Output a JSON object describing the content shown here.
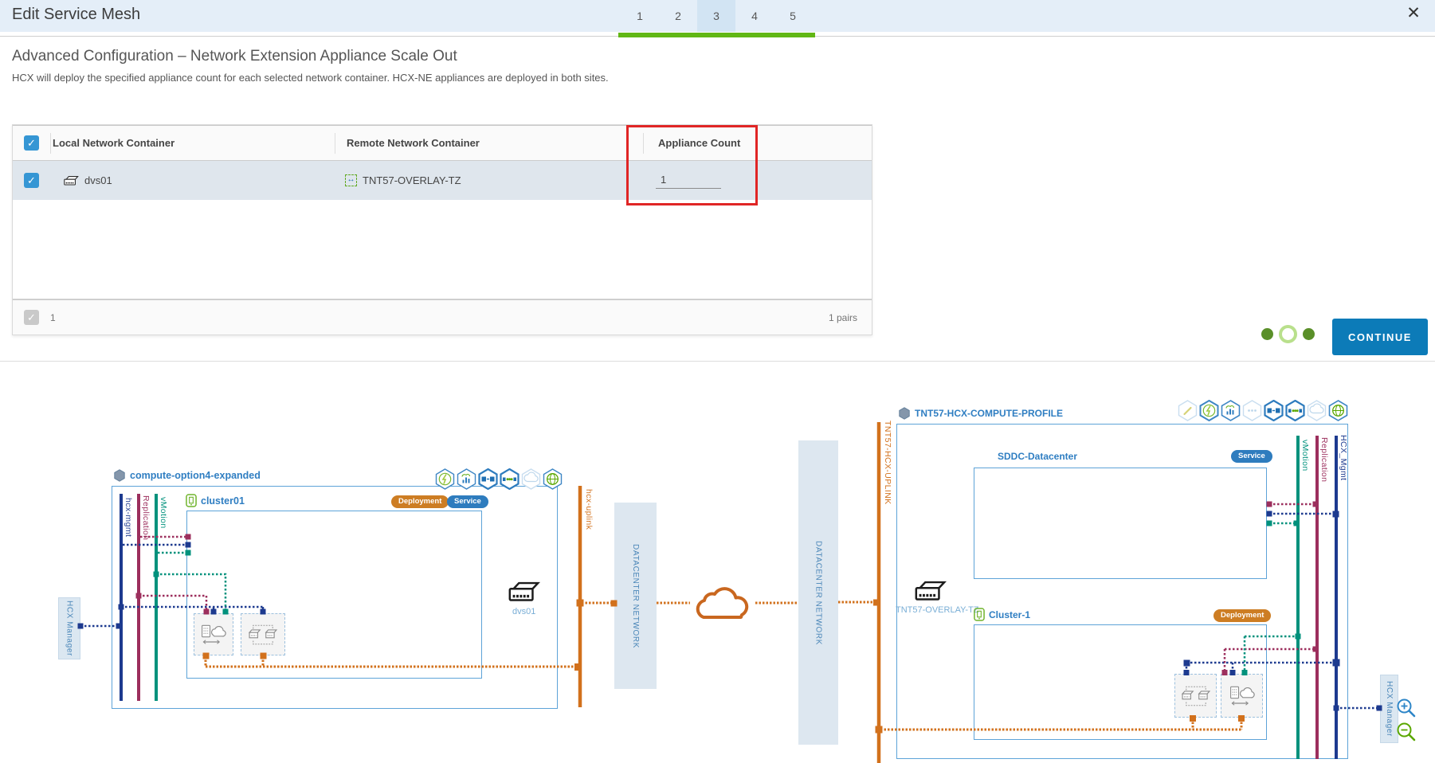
{
  "header": {
    "title": "Edit Service Mesh",
    "steps": [
      "1",
      "2",
      "3",
      "4",
      "5"
    ],
    "active_step": "3",
    "close_icon": "✕"
  },
  "intro": {
    "heading": "Advanced Configuration – Network Extension Appliance Scale Out",
    "description": "HCX will deploy the specified appliance count for each selected network container. HCX-NE appliances are deployed in both sites."
  },
  "table": {
    "columns": [
      "Local Network Container",
      "Remote Network Container",
      "Appliance Count"
    ],
    "rows": [
      {
        "local": "dvs01",
        "remote": "TNT57-OVERLAY-TZ",
        "appliance_count": "1",
        "selected": true
      }
    ],
    "footer": {
      "selected_count": "1",
      "pairs": "1 pairs"
    }
  },
  "actions": {
    "continue_label": "CONTINUE"
  },
  "diagram": {
    "left": {
      "profile": "compute-option4-expanded",
      "manager": "HCX Manager",
      "nets": [
        "hcx-mgmt",
        "Replication",
        "vMotion"
      ],
      "cluster": "cluster01",
      "badges": [
        "Deployment",
        "Service"
      ],
      "switch": "dvs01",
      "uplink": "hcx-uplink",
      "dc_network": "DATACENTER NETWORK"
    },
    "right": {
      "profile": "TNT57-HCX-COMPUTE-PROFILE",
      "uplink": "TNT57-HCX-UPLINK",
      "dc_network": "DATACENTER NETWORK",
      "datacenter": "SDDC-Datacenter",
      "dc_badge": "Service",
      "nets": [
        "vMotion",
        "Replication",
        "HCX_Mgmt"
      ],
      "cluster": "Cluster-1",
      "cluster_badge": "Deployment",
      "switch": "TNT57-OVERLAY-TZ",
      "manager": "HCX Manager"
    },
    "icons": {
      "left_hex_icons": [
        "power-hex-icon",
        "wan-chart-hex-icon",
        "network-extension-hex-icon",
        "traffic-dots-hex-icon",
        "cloud-hex-icon",
        "globe-hex-icon"
      ],
      "right_hex_icons": [
        "edit-hex-icon",
        "power-hex-icon",
        "wan-chart-hex-icon",
        "dots-faint-hex-icon",
        "network-extension-hex-icon",
        "traffic-dots-hex-icon",
        "cloud-hex-icon",
        "globe-hex-icon"
      ],
      "other": [
        "switch-icon",
        "cluster-icon",
        "cloud-wan-icon",
        "zoom-in-icon",
        "zoom-out-icon",
        "checkbox-check-icon",
        "transport-zone-icon",
        "hexagon-profile-icon"
      ]
    }
  },
  "colors": {
    "header_bg": "#e4eef8",
    "accent_blue": "#0c7bb8",
    "progress_green": "#61b715",
    "line_navy": "#1d3a8f",
    "line_maroon": "#9c2f5d",
    "line_teal": "#00917c",
    "line_orange": "#d2711c",
    "annotation_red": "#e02525",
    "badge_orange": "#cd7d23",
    "badge_blue": "#2e7cbe"
  }
}
